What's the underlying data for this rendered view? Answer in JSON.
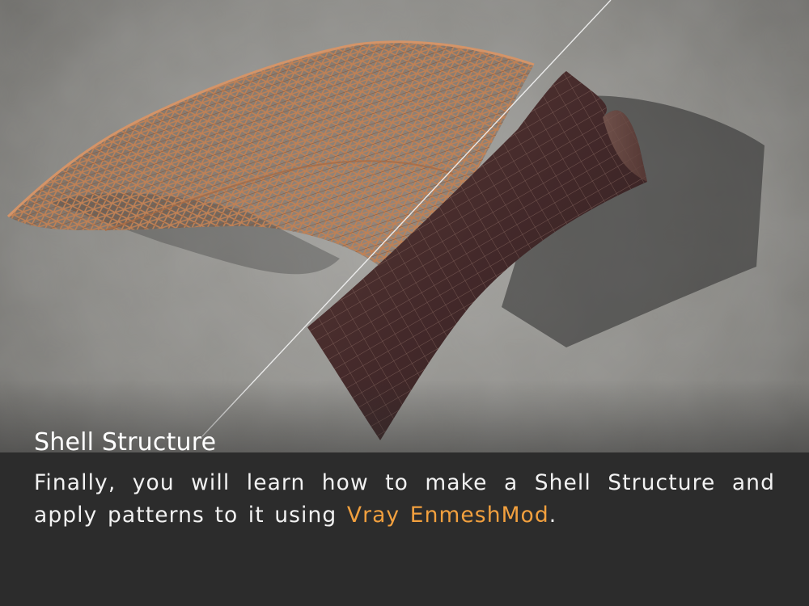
{
  "caption": {
    "title": "Shell Structure",
    "body_before": "Finally, you will learn how to make a Shell Structure and apply patterns to it using ",
    "body_highlight": "Vray EnmeshMod",
    "body_after": "."
  },
  "colors": {
    "highlight": "#f2a03e",
    "caption_background": "#2c2c2c",
    "floor": "#8a8a87",
    "lattice": "#b9784f",
    "surface": "#4a2e2a"
  },
  "render": {
    "left_half": "lattice-shell",
    "right_half": "solid-shell-surface"
  }
}
